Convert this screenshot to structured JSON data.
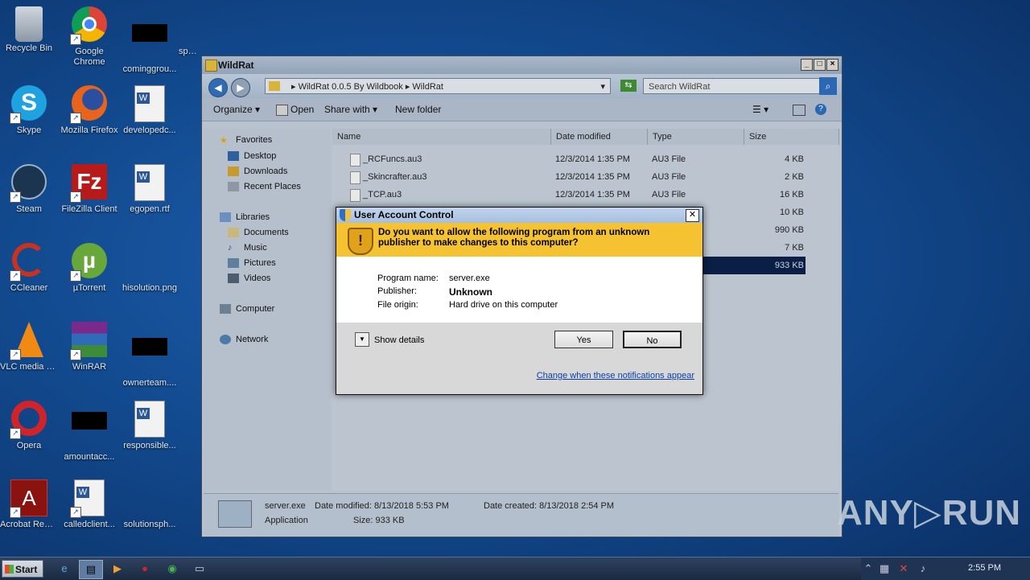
{
  "desktop": {
    "icons": [
      {
        "label": "Recycle Bin",
        "icon": "recycle-bin-icon"
      },
      {
        "label": "Google Chrome",
        "icon": "chrome-icon"
      },
      {
        "label": "cominggrou...",
        "icon": "file-thumbnail-icon"
      },
      {
        "label": "spacedoes...",
        "icon": "file-thumbnail-icon"
      },
      {
        "label": "Skype",
        "icon": "skype-icon"
      },
      {
        "label": "Mozilla Firefox",
        "icon": "firefox-icon"
      },
      {
        "label": "developedc...",
        "icon": "word-doc-icon"
      },
      {
        "label": "Steam",
        "icon": "steam-icon"
      },
      {
        "label": "FileZilla Client",
        "icon": "filezilla-icon"
      },
      {
        "label": "egopen.rtf",
        "icon": "word-doc-icon"
      },
      {
        "label": "CCleaner",
        "icon": "ccleaner-icon"
      },
      {
        "label": "µTorrent",
        "icon": "utorrent-icon"
      },
      {
        "label": "hisolution.png",
        "icon": "image-file-icon"
      },
      {
        "label": "VLC media player",
        "icon": "vlc-icon"
      },
      {
        "label": "WinRAR",
        "icon": "winrar-icon"
      },
      {
        "label": "ownerteam....",
        "icon": "file-thumbnail-icon"
      },
      {
        "label": "Opera",
        "icon": "opera-icon"
      },
      {
        "label": "amountacc...",
        "icon": "file-thumbnail-icon"
      },
      {
        "label": "responsible...",
        "icon": "word-doc-icon"
      },
      {
        "label": "Acrobat Reader DC",
        "icon": "acrobat-icon"
      },
      {
        "label": "calledclient...",
        "icon": "word-doc-icon"
      },
      {
        "label": "solutionsph...",
        "icon": "image-file-icon"
      }
    ]
  },
  "explorer": {
    "title": "WildRat",
    "address": "▸  WildRat 0.0.5 By Wildbook  ▸  WildRat",
    "search_placeholder": "Search WildRat",
    "toolbar": {
      "organize": "Organize ▾",
      "open": "Open",
      "share": "Share with ▾",
      "new_folder": "New folder"
    },
    "nav": {
      "favorites": "Favorites",
      "desktop": "Desktop",
      "downloads": "Downloads",
      "recent": "Recent Places",
      "libraries": "Libraries",
      "documents": "Documents",
      "music": "Music",
      "pictures": "Pictures",
      "videos": "Videos",
      "computer": "Computer",
      "network": "Network"
    },
    "columns": {
      "name": "Name",
      "date": "Date modified",
      "type": "Type",
      "size": "Size"
    },
    "files": [
      {
        "name": "_RCFuncs.au3",
        "date": "12/3/2014 1:35 PM",
        "type": "AU3 File",
        "size": "4 KB"
      },
      {
        "name": "_Skincrafter.au3",
        "date": "12/3/2014 1:35 PM",
        "type": "AU3 File",
        "size": "2 KB"
      },
      {
        "name": "_TCP.au3",
        "date": "12/3/2014 1:35 PM",
        "type": "AU3 File",
        "size": "16 KB"
      },
      {
        "size": "10 KB"
      },
      {
        "size": "990 KB"
      },
      {
        "size": "7 KB"
      },
      {
        "size": "933 KB"
      }
    ],
    "status": {
      "filename": "server.exe",
      "date_modified": "Date modified: 8/13/2018 5:53 PM",
      "date_created": "Date created: 8/13/2018 2:54 PM",
      "kind": "Application",
      "size": "Size: 933 KB"
    }
  },
  "uac": {
    "title": "User Account Control",
    "question": "Do you want to allow the following program from an unknown publisher to make changes to this computer?",
    "program_label": "Program name:",
    "program_value": "server.exe",
    "publisher_label": "Publisher:",
    "publisher_value": "Unknown",
    "origin_label": "File origin:",
    "origin_value": "Hard drive on this computer",
    "show_details": "Show details",
    "yes": "Yes",
    "no": "No",
    "link": "Change when these notifications appear"
  },
  "taskbar": {
    "start": "Start",
    "clock": "2:55 PM"
  },
  "watermark": "ANY▷RUN"
}
